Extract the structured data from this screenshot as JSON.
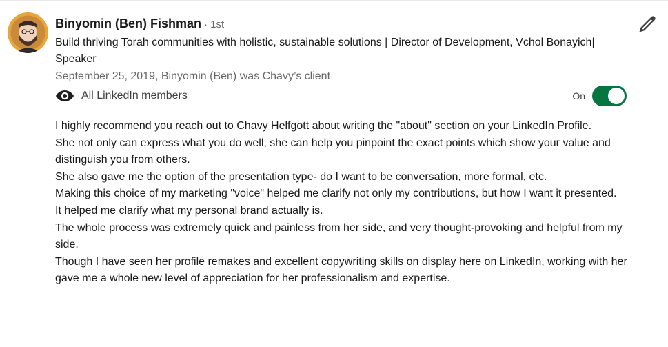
{
  "recommendation": {
    "author_name": "Binyomin (Ben) Fishman",
    "degree": "· 1st",
    "headline": "Build thriving Torah communities with holistic, sustainable solutions | Director of Development, Vchol Bonayich| Speaker",
    "meta": "September 25, 2019, Binyomin (Ben) was Chavy’s client",
    "visibility_label": "All LinkedIn members",
    "toggle_state": "On",
    "paragraphs": [
      "I highly recommend you reach out to Chavy Helfgott about writing the \"about\" section on your LinkedIn Profile.",
      "She not only can express what you do well, she can help you pinpoint the exact points which show your value and distinguish you from others.",
      "She also gave me the option of the presentation type- do I want to be conversation, more formal, etc.",
      "Making this choice of my marketing \"voice\" helped me clarify not only my contributions, but how I want it presented.",
      "It helped me clarify what my personal brand actually is.",
      "The whole process was extremely quick and painless from her side, and very thought-provoking and helpful from my side.",
      "Though I have seen her profile remakes and excellent copywriting skills on display here on LinkedIn, working with her gave me a whole new level of appreciation for her professionalism and expertise."
    ]
  },
  "icons": {
    "avatar": "profile-photo",
    "visibility": "eye-icon",
    "edit": "pencil-icon"
  },
  "colors": {
    "toggle_on": "#057642",
    "secondary_text": "#666666"
  }
}
